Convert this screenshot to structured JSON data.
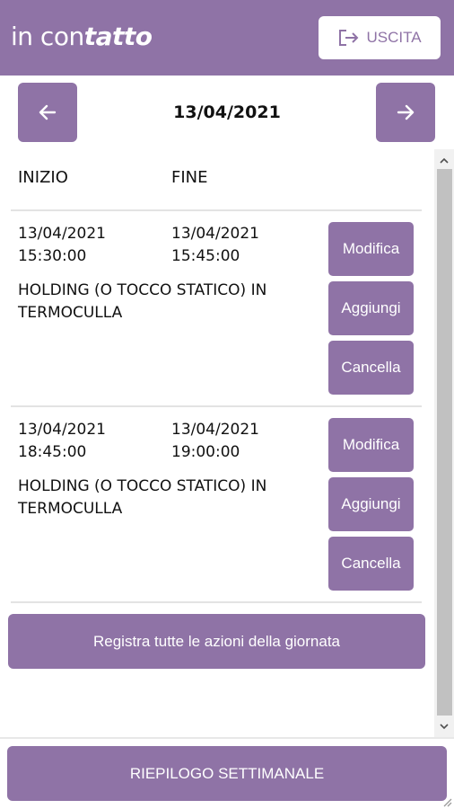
{
  "header": {
    "brand_prefix": "in con",
    "brand_suffix": "tatto",
    "logout_label": "USCITA",
    "logout_icon": "logout-icon"
  },
  "nav": {
    "date": "13/04/2021",
    "prev_icon": "arrow-left-icon",
    "next_icon": "arrow-right-icon"
  },
  "columns": {
    "start": "INIZIO",
    "end": "FINE"
  },
  "entries": [
    {
      "start": "13/04/2021\n15:30:00",
      "end": "13/04/2021\n15:45:00",
      "description": "HOLDING (O TOCCO STATICO) IN TERMOCULLA",
      "edit_label": "Modifica",
      "add_label": "Aggiungi",
      "delete_label": "Cancella"
    },
    {
      "start": "13/04/2021\n18:45:00",
      "end": "13/04/2021\n19:00:00",
      "description": "HOLDING (O TOCCO STATICO) IN TERMOCULLA",
      "edit_label": "Modifica",
      "add_label": "Aggiungi",
      "delete_label": "Cancella"
    }
  ],
  "register_label": "Registra tutte le azioni della giornata",
  "summary_label": "RIEPILOGO SETTIMANALE",
  "colors": {
    "accent": "#8f73a6",
    "text": "#111111",
    "divider": "#e3e3e3"
  }
}
